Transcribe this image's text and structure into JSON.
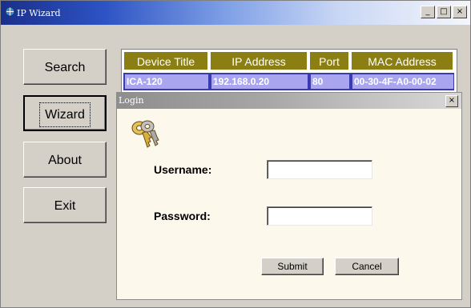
{
  "window": {
    "title": "IP Wizard",
    "controls": {
      "minimize": "_",
      "maximize": "□",
      "close": "×"
    }
  },
  "sidebar": {
    "buttons": [
      {
        "label": "Search"
      },
      {
        "label": "Wizard"
      },
      {
        "label": "About"
      },
      {
        "label": "Exit"
      }
    ]
  },
  "device_table": {
    "headers": [
      "Device Title",
      "IP Address",
      "Port",
      "MAC Address"
    ],
    "rows": [
      [
        "ICA-120",
        "192.168.0.20",
        "80",
        "00-30-4F-A0-00-02"
      ]
    ]
  },
  "login_dialog": {
    "title": "Login",
    "close": "×",
    "icon": "keys-icon",
    "username_label": "Username:",
    "username_value": "",
    "password_label": "Password:",
    "password_value": "",
    "submit_label": "Submit",
    "cancel_label": "Cancel"
  },
  "colors": {
    "header_bg": "#8b7e13",
    "row_selected": "#a9a6ef",
    "dialog_bg": "#fdf8ec",
    "window_bg": "#d4d0c8"
  }
}
